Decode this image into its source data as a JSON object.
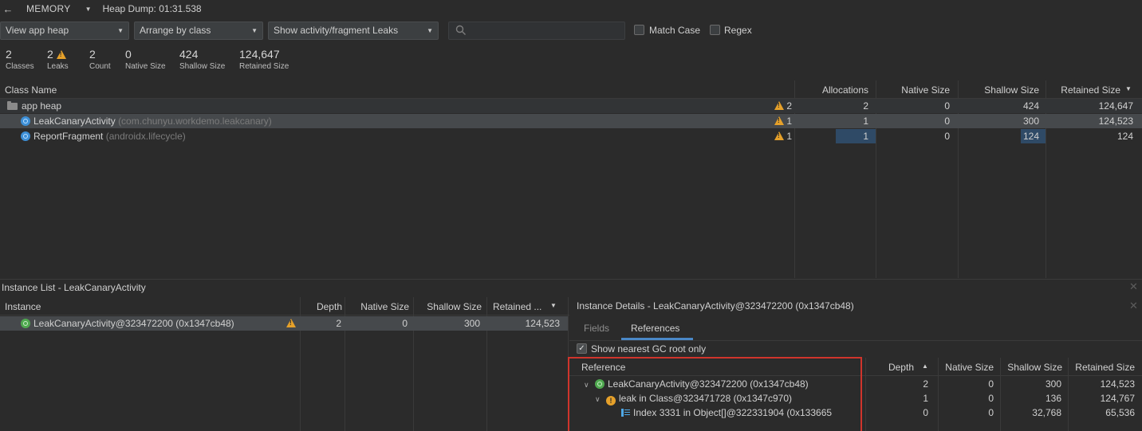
{
  "toolbar": {
    "back_icon": "arrow-left-icon",
    "session_label": "MEMORY",
    "heap_dump_label": "Heap Dump: 01:31.538"
  },
  "filters": {
    "view_select": "View app heap",
    "arrange_select": "Arrange by class",
    "leaks_select": "Show activity/fragment Leaks",
    "search_placeholder": "",
    "match_case_label": "Match Case",
    "regex_label": "Regex",
    "match_case_checked": false,
    "regex_checked": false
  },
  "stats": [
    {
      "value": "2",
      "label": "Classes"
    },
    {
      "value": "2",
      "label": "Leaks"
    },
    {
      "value": "2",
      "label": "Count"
    },
    {
      "value": "0",
      "label": "Native Size"
    },
    {
      "value": "424",
      "label": "Shallow Size"
    },
    {
      "value": "124,647",
      "label": "Retained Size"
    }
  ],
  "class_table": {
    "columns": [
      "Class Name",
      "Allocations",
      "Native Size",
      "Shallow Size",
      "Retained Size"
    ],
    "sort_indicator": "▼",
    "rows": [
      {
        "name": "app heap",
        "pkg": "",
        "leaks": "2",
        "allocations": "2",
        "native": "0",
        "shallow": "424",
        "retained": "124,647"
      },
      {
        "name": "LeakCanaryActivity",
        "pkg": "(com.chunyu.workdemo.leakcanary)",
        "leaks": "1",
        "allocations": "1",
        "native": "0",
        "shallow": "300",
        "retained": "124,523"
      },
      {
        "name": "ReportFragment",
        "pkg": "(androidx.lifecycle)",
        "leaks": "1",
        "allocations": "1",
        "native": "0",
        "shallow": "124",
        "retained": "124"
      }
    ]
  },
  "instance_list": {
    "title": "Instance List - LeakCanaryActivity",
    "columns": [
      "Instance",
      "Depth",
      "Native Size",
      "Shallow Size",
      "Retained ..."
    ],
    "sort_indicator": "▼",
    "rows": [
      {
        "name": "LeakCanaryActivity@323472200 (0x1347cb48)",
        "depth": "2",
        "native": "0",
        "shallow": "300",
        "retained": "124,523"
      }
    ]
  },
  "instance_details": {
    "title": "Instance Details - LeakCanaryActivity@323472200 (0x1347cb48)",
    "tabs": [
      "Fields",
      "References"
    ],
    "active_tab": "References",
    "gc_root_label": "Show nearest GC root only",
    "gc_root_checked": true,
    "columns": [
      "Reference",
      "Depth",
      "Native Size",
      "Shallow Size",
      "Retained Size"
    ],
    "sort_indicator": "▲",
    "rows": [
      {
        "name": "LeakCanaryActivity@323472200 (0x1347cb48)",
        "depth": "2",
        "native": "0",
        "shallow": "300",
        "retained": "124,523"
      },
      {
        "name": "leak in Class@323471728 (0x1347c970)",
        "depth": "1",
        "native": "0",
        "shallow": "136",
        "retained": "124,767"
      },
      {
        "name": "Index 3331 in Object[]@322331904 (0x133665",
        "depth": "0",
        "native": "0",
        "shallow": "32,768",
        "retained": "65,536"
      }
    ]
  },
  "colors": {
    "background": "#2b2b2b",
    "selection": "#464a4d",
    "highlight": "#2f4a66",
    "warning": "#e6a12a",
    "annotation_box": "#d0342c"
  }
}
